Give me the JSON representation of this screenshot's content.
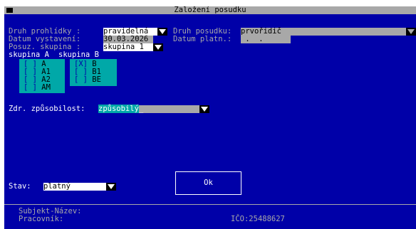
{
  "window": {
    "title": "Založení posudku"
  },
  "form": {
    "druh_prohlidky_label": "Druh prohlídky :",
    "druh_prohlidky_value": "pravidelná",
    "druh_posudku_label": "Druh posudku:",
    "druh_posudku_value": "prvořidič",
    "datum_vystaveni_label": "Datum vystavení:",
    "datum_vystaveni_value": "30.03.2026",
    "datum_platn_label": "Datum platn.:",
    "datum_platn_value": " .  .",
    "posuz_skupina_label": "Posuz. skupina :",
    "posuz_skupina_value": "skupina 1",
    "skupina_a_label": "skupina A",
    "skupina_b_label": "skupina B",
    "groupA": [
      {
        "mark": "[ ]",
        "label": "A"
      },
      {
        "mark": "[ ]",
        "label": "A1"
      },
      {
        "mark": "[ ]",
        "label": "A2"
      },
      {
        "mark": "[ ]",
        "label": "AM"
      }
    ],
    "groupB": [
      {
        "mark": "[X]",
        "label": "B"
      },
      {
        "mark": "[ ]",
        "label": "B1"
      },
      {
        "mark": "[ ]",
        "label": "BE"
      }
    ],
    "zdr_label": "Zdr. způsobilost:",
    "zdr_value": "způsobilý",
    "stav_label": "Stav:",
    "stav_value": "platný",
    "ok_label": "Ok"
  },
  "footer": {
    "subjekt_label": "Subjekt-Název:",
    "pracovnik_label": "Pracovník:",
    "ico_label": "IČO:",
    "ico_value": "25488627"
  },
  "colors": {
    "background": "#0000a8",
    "label": "#a8a8a8",
    "field": "#ffffff",
    "checkbox_group": "#00a8a8"
  }
}
